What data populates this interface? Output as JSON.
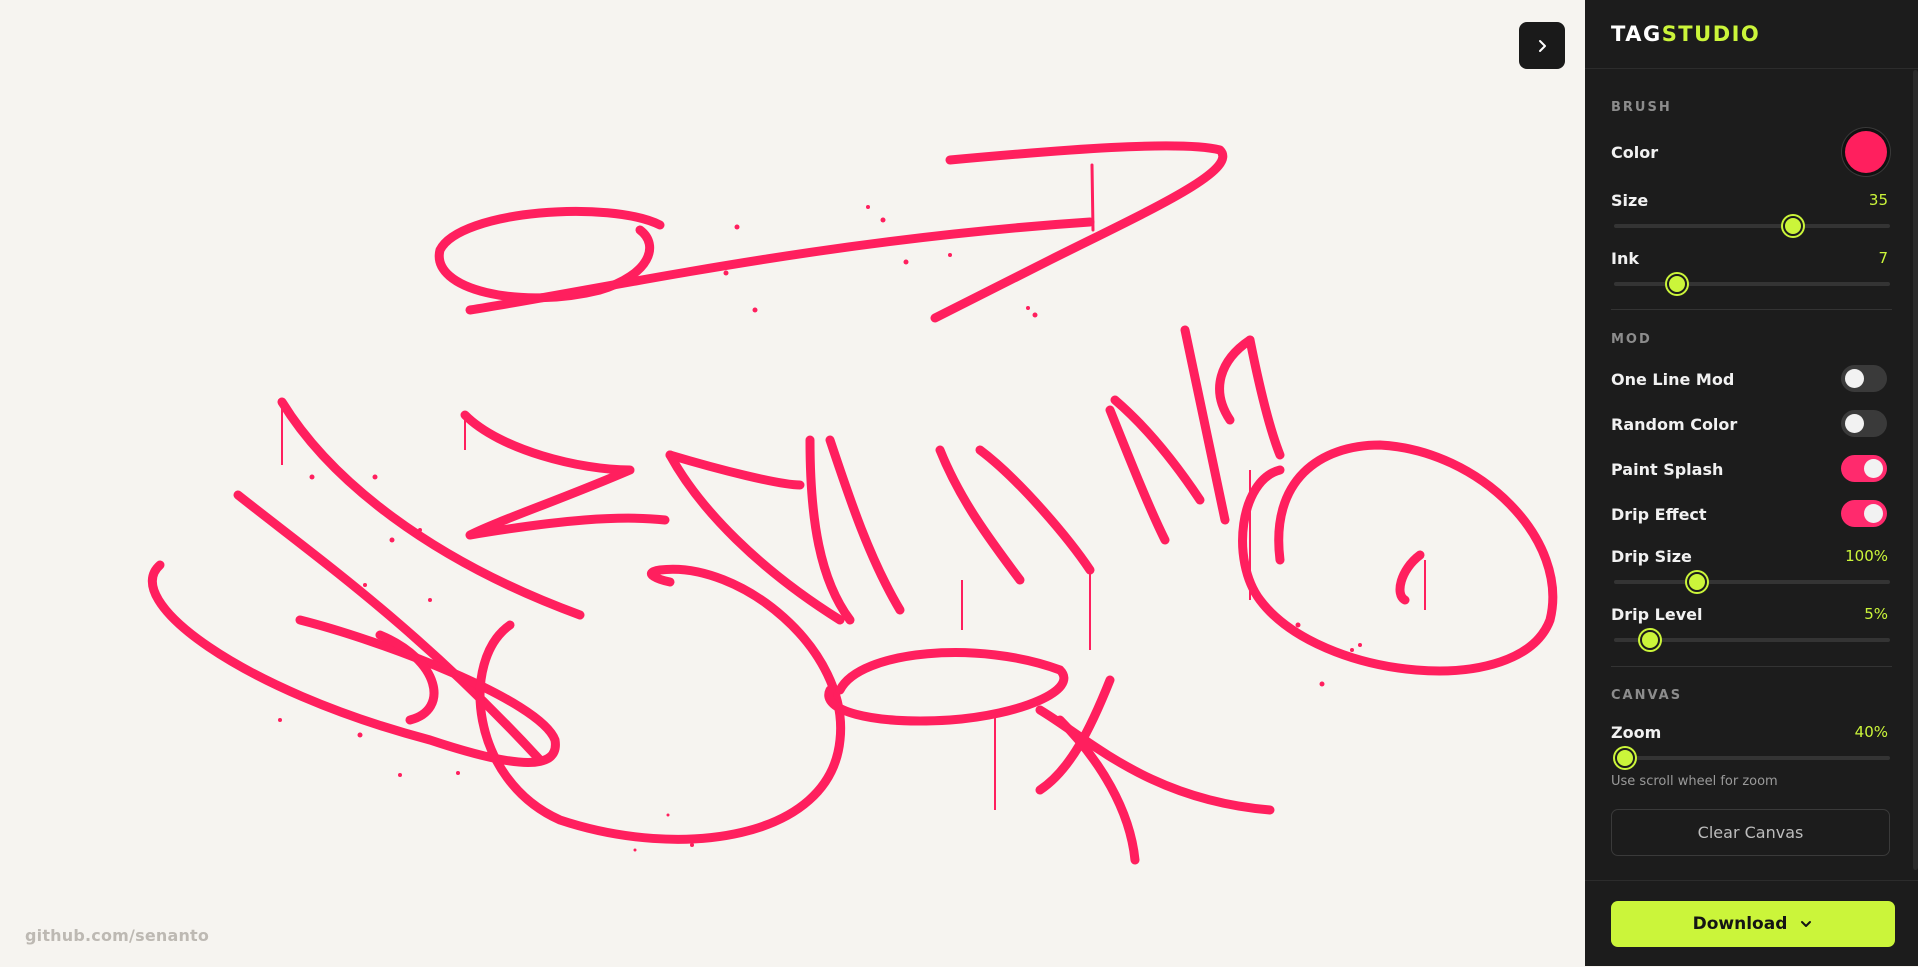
{
  "app": {
    "logo_part1": "TAG",
    "logo_part2": "STUDIO",
    "footer_link": "github.com/senanto",
    "accent_color": "#cbf53a",
    "brush_color": "#ff1f5e"
  },
  "brush": {
    "section_title": "BRUSH",
    "color_label": "Color",
    "size_label": "Size",
    "size_value": "35",
    "size_fraction": 0.65,
    "ink_label": "Ink",
    "ink_value": "7",
    "ink_fraction": 0.23
  },
  "mod": {
    "section_title": "MOD",
    "toggles": [
      {
        "label": "One Line Mod",
        "on": false
      },
      {
        "label": "Random Color",
        "on": false
      },
      {
        "label": "Paint Splash",
        "on": true
      },
      {
        "label": "Drip Effect",
        "on": true
      }
    ],
    "drip_size_label": "Drip Size",
    "drip_size_value": "100%",
    "drip_size_fraction": 0.3,
    "drip_level_label": "Drip Level",
    "drip_level_value": "5%",
    "drip_level_fraction": 0.13
  },
  "canvas": {
    "section_title": "CANVAS",
    "zoom_label": "Zoom",
    "zoom_value": "40%",
    "zoom_fraction": 0.04,
    "zoom_hint": "Use scroll wheel for zoom",
    "clear_label": "Clear Canvas"
  },
  "download": {
    "label": "Download"
  },
  "icons": {
    "collapse": "chevron-right-icon",
    "download_menu": "chevron-down-icon"
  }
}
